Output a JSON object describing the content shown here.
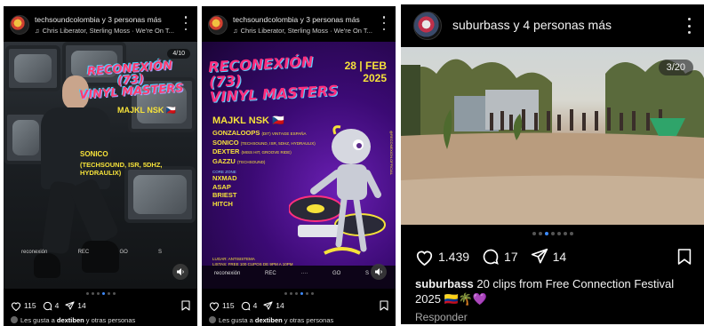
{
  "posts": [
    {
      "header": {
        "user": "techsoundcolombia y 3 personas más",
        "music": "Chris Liberator, Sterling Moss · We're On T..."
      },
      "media": {
        "counter": "4/10",
        "title_lines": [
          "RECONEXIÓN (73)",
          "VINYL MASTERS"
        ],
        "artist": "MAJKL NSK",
        "flag": "🇨🇿",
        "performer": "SONICO",
        "performer_sub": "(TECHSOUND, ISR, 5DHZ, HYDRAULIX)",
        "logos": [
          "reconexión",
          "REC",
          "GO",
          "S"
        ]
      },
      "indicator": {
        "count": 6,
        "active": 3
      },
      "actions": {
        "likes": "115",
        "comments": "4",
        "shares": "14"
      },
      "liked_by": {
        "prefix": "Les gusta a ",
        "user": "dextiben",
        "suffix": " y otras personas"
      }
    },
    {
      "header": {
        "user": "techsoundcolombia y 3 personas más",
        "music": "Chris Liberator, Sterling Moss · We're On T..."
      },
      "media": {
        "title_lines": [
          "RECONEXIÓN (73)",
          "VINYL MASTERS"
        ],
        "date_top": "28 | FEB",
        "date_year": "2025",
        "headliner": "MAJKL NSK",
        "flag": "🇨🇿",
        "lineup": [
          {
            "name": "GONZALOOPS",
            "note": "(DIT) VINTAGE ESPAÑA"
          },
          {
            "name": "SONICO",
            "note": "(TECHSOUND, ISR, 5DHZ, HYDRAULIX)"
          },
          {
            "name": "DEXTER",
            "note": "(MISS HIT, GROOVE RIDE)"
          },
          {
            "name": "GAZZU",
            "note": "(TECHSOUND)"
          }
        ],
        "section_label": "CORE ZONE",
        "core": [
          "NXMAD",
          "ASAP",
          "BRIEST",
          "HITCH"
        ],
        "info": [
          "LUGAR: ANTISISTEMA",
          "LISTAS: FREE 100 CUPOS DE 9PM A 10PM",
          "20K HASTA LAS 12AM, LUEGO 30K INDIVIDUAL"
        ],
        "vertical_text": "@RECONEXION.OFFICIAL",
        "logos": [
          "reconexión",
          "REC",
          "····",
          "GO",
          "S"
        ]
      },
      "indicator": {
        "count": 6,
        "active": 3
      },
      "actions": {
        "likes": "115",
        "comments": "4",
        "shares": "14"
      },
      "liked_by": {
        "prefix": "Les gusta a ",
        "user": "dextiben",
        "suffix": " y otras personas"
      }
    },
    {
      "header": {
        "user": "suburbass y 4 personas más"
      },
      "media": {
        "counter": "3/20"
      },
      "indicator": {
        "count": 7,
        "active": 2
      },
      "actions": {
        "likes": "1.439",
        "comments": "17",
        "shares": "14"
      },
      "caption": {
        "user": "suburbass",
        "text": " 20 clips from Free Connection Festival 2025 🇨🇴🌴💜"
      },
      "reply_label": "Responder"
    }
  ],
  "colors": {
    "background": "#000000",
    "accent_blue": "#3d8bff",
    "poster_yellow": "#f6e23a",
    "poster_pink": "#ff2f7e",
    "poster_purple": "#3b0a74"
  },
  "icons": [
    "heart-icon",
    "comment-icon",
    "share-icon",
    "bookmark-icon",
    "more-icon",
    "music-note-icon",
    "volume-icon"
  ]
}
